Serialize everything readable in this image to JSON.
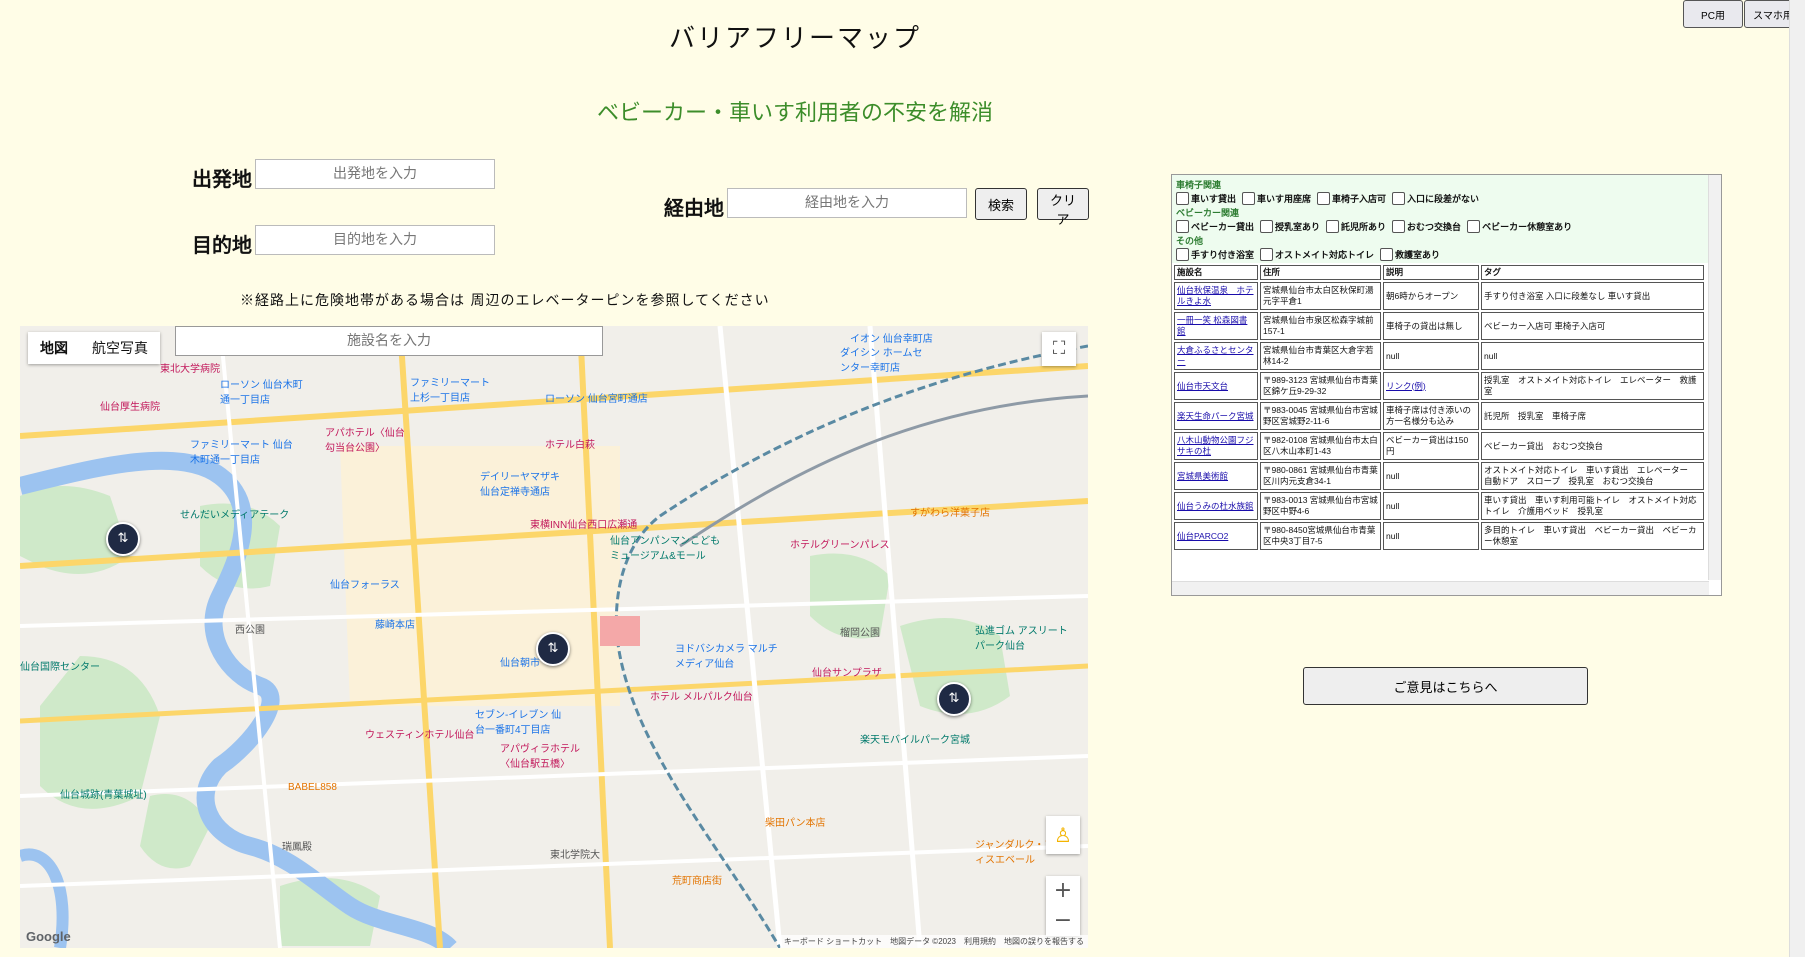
{
  "header": {
    "title": "バリアフリーマップ",
    "subtitle": "ベビーカー・車いす利用者の不安を解消"
  },
  "view_toggle": {
    "pc": "PC用",
    "mobile": "スマホ用"
  },
  "route": {
    "origin_label": "出発地",
    "origin_placeholder": "出発地を入力",
    "destination_label": "目的地",
    "destination_placeholder": "目的地を入力",
    "via_label": "経由地",
    "via_placeholder": "経由地を入力",
    "search_button": "検索",
    "clear_button": "クリア"
  },
  "notice": "※経路上に危険地帯がある場合は 周辺のエレベーターピンを参照してください",
  "map": {
    "tab_map": "地図",
    "tab_satellite": "航空写真",
    "facility_placeholder": "施設名を入力",
    "zoom_in": "+",
    "zoom_out": "−",
    "attribution": "キーボード ショートカット　地図データ ©2023　利用規約　地図の誤りを報告する",
    "google": "Google",
    "labels": [
      "仙台厚生病院",
      "東北大学病院",
      "ローソン 仙台木町通一丁目店",
      "ファミリーマート 上杉一丁目店",
      "ファミリーマート 仙台木町通一丁目店",
      "アパホテル〈仙台 勾当台公園〉",
      "ホテル白萩",
      "ローソン 仙台宮町通店",
      "デイリーヤマザキ 仙台定禅寺通店",
      "セブン-イレブン 仙台一番町4丁目店",
      "せんだいメディアテーク",
      "東横INN仙台西口広瀬通",
      "仙台アンパンマンこどもミュージアム&モール",
      "ホテルグリーンパレス",
      "すがわら洋菓子店",
      "仙台フォーラス",
      "藤崎本店",
      "仙台朝市",
      "ヨドバシカメラ マルチメディア仙台",
      "仙台サンプラザ",
      "ホテル メルパルク仙台",
      "ウェスティンホテル仙台",
      "アパヴィラホテル〈仙台駅五橋〉",
      "楽天モバイルパーク宮城",
      "仙台城跡(青葉城址)",
      "BABEL858",
      "瑞鳳殿",
      "柴田パン本店",
      "ジャンダルク・フィスエベール",
      "荒町商店街",
      "榴岡公園",
      "西公園",
      "仙台国際センター",
      "弘進ゴム アスリートパーク仙台",
      "東北学院大",
      "ダイシン ホームセンター幸町店",
      "イオン 仙台幸町店"
    ]
  },
  "filters": {
    "groups": [
      {
        "heading": "車椅子関連",
        "options": [
          "車いす貸出",
          "車いす用座席",
          "車椅子入店可",
          "入口に段差がない"
        ]
      },
      {
        "heading": "ベビーカー関連",
        "options": [
          "ベビーカー貸出",
          "授乳室あり",
          "託児所あり",
          "おむつ交換台",
          "ベビーカー休憩室あり"
        ]
      },
      {
        "heading": "その他",
        "options": [
          "手すり付き浴室",
          "オストメイト対応トイレ",
          "救護室あり"
        ]
      }
    ]
  },
  "table": {
    "headers": [
      "施設名",
      "住所",
      "説明",
      "タグ"
    ],
    "rows": [
      [
        "仙台秋保温泉　ホテルきよ水",
        "宮城県仙台市太白区秋保町湯元字平倉1",
        "朝6時からオープン",
        "手すり付き浴室 入口に段差なし 車いす貸出"
      ],
      [
        "一冊一笑 松森図書館",
        "宮城県仙台市泉区松森字城前157-1",
        "車椅子の貸出は無し",
        "ベビーカー入店可 車椅子入店可"
      ],
      [
        "大倉ふるさとセンター",
        "宮城県仙台市青葉区大倉字若林14-2",
        "null",
        "null"
      ],
      [
        "仙台市天文台",
        "〒989-3123 宮城県仙台市青葉区錦ケ丘9-29-32",
        "リンク(例)",
        "授乳室　オストメイト対応トイレ　エレベーター　救護室"
      ],
      [
        "楽天生命パーク宮城",
        "〒983-0045 宮城県仙台市宮城野区宮城野2-11-6",
        "車椅子席は付き添いの方一名様分も込み",
        "託児所　授乳室　車椅子席"
      ],
      [
        "八木山動物公園フジサキの杜",
        "〒982-0108 宮城県仙台市太白区八木山本町1-43",
        "ベビーカー貸出は150円",
        "ベビーカー貸出　おむつ交換台"
      ],
      [
        "宮城県美術館",
        "〒980-0861 宮城県仙台市青葉区川内元支倉34-1",
        "null",
        "オストメイト対応トイレ　車いす貸出　エレベーター　自動ドア　スロープ　授乳室　おむつ交換台"
      ],
      [
        "仙台うみの杜水族館",
        "〒983-0013 宮城県仙台市宮城野区中野4-6",
        "null",
        "車いす貸出　車いす利用可能トイレ　オストメイト対応トイレ　介護用ベッド　授乳室"
      ],
      [
        "仙台PARCO2",
        "〒980-8450宮城県仙台市青葉区中央3丁目7-5",
        "null",
        "多目的トイレ　車いす貸出　ベビーカー貸出　ベビーカー休憩室"
      ]
    ]
  },
  "feedback_button": "ご意見はこちらへ"
}
